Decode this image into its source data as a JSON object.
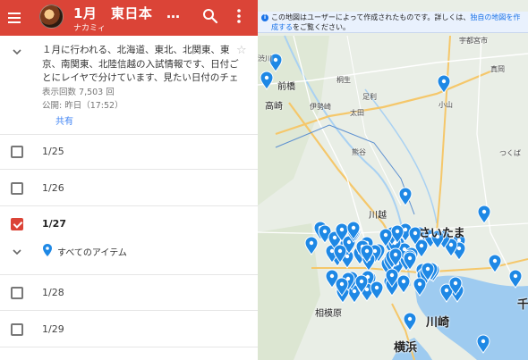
{
  "header": {
    "title": "1月　東日本　入試…",
    "owner": "ナカミィ"
  },
  "description": {
    "text": "１月に行われる、北海道、東北、北関東、東京、南関東、北陸信越の入試情報です、日付ごとにレイヤで分けています、見たい日付のチェ",
    "views": "表示回数 7,503 回",
    "published": "公開: 昨日（17:52）",
    "share_label": "共有"
  },
  "layers": [
    {
      "label": "1/25",
      "checked": false
    },
    {
      "label": "1/26",
      "checked": false
    },
    {
      "label": "1/27",
      "checked": true
    },
    {
      "label": "1/28",
      "checked": false
    },
    {
      "label": "1/29",
      "checked": false
    }
  ],
  "sublayer": {
    "label": "すべてのアイテム"
  },
  "map": {
    "info_text": "この地図はユーザーによって作成されたものです。詳しくは、",
    "info_link": "独自の地図を作成する",
    "info_suffix": "をご覧ください。",
    "cities": {
      "maebashi": "前橋",
      "takasaki": "高崎",
      "kiryu": "桐生",
      "ashikaga": "足利",
      "isesaki": "伊勢崎",
      "ota": "太田",
      "oyama": "小山",
      "kumagaya": "熊谷",
      "kawagoe": "川越",
      "saitama": "さいたま",
      "sagamihara": "相模原",
      "kawasaki": "川崎",
      "yokohama": "横浜",
      "chiba": "千",
      "utsunomiya": "宇都宮市",
      "mooka": "真岡",
      "tsukuba": "つくば",
      "shibukawa": "渋川"
    },
    "colors": {
      "pin": "#1e88e5",
      "water": "#9ecbf0",
      "road": "#ffffff",
      "expressway": "#f5c76a"
    }
  }
}
